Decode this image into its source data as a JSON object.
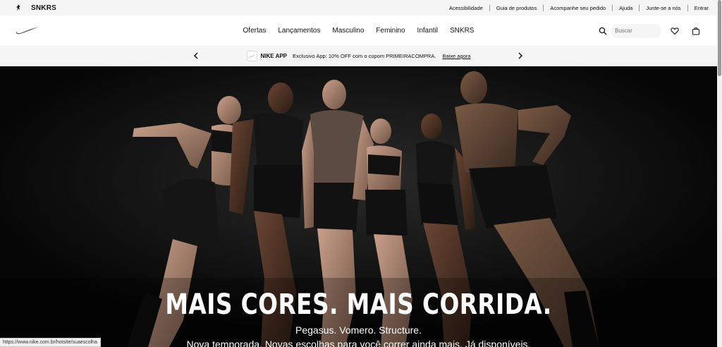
{
  "utility_bar": {
    "brands": {
      "jordan_icon": "jordan-jumpman-icon",
      "snkrs": "SNKRS"
    },
    "links": [
      "Acessibilidade",
      "Guia de produtos",
      "Acompanhe seu pedido",
      "Ajuda",
      "Junte-se a nós",
      "Entrar"
    ]
  },
  "header": {
    "logo_icon": "nike-swoosh-icon",
    "nav": [
      "Ofertas",
      "Lançamentos",
      "Masculino",
      "Feminino",
      "Infantil",
      "SNKRS"
    ],
    "search_placeholder": "Buscar",
    "icons": [
      "search-icon",
      "heart-icon",
      "bag-icon"
    ]
  },
  "promo": {
    "app_label": "NIKE APP",
    "message": "Exclusivo App: 10% OFF com o cupom PRIMEIRACOMPRA.",
    "link": "Baixe agora"
  },
  "hero": {
    "title": "MAIS CORES. MAIS CORRIDA.",
    "subtitle": "Pegasus. Vomero. Structure.",
    "description": "Nova temporada. Novas escolhas para você correr ainda mais. Já disponíveis."
  },
  "status_url": "https://www.nike.com.br/hotsite/suaescolha",
  "colors": {
    "hero_bg": "#0a0a0a",
    "bar_bg": "#f5f5f5",
    "text": "#111111"
  }
}
